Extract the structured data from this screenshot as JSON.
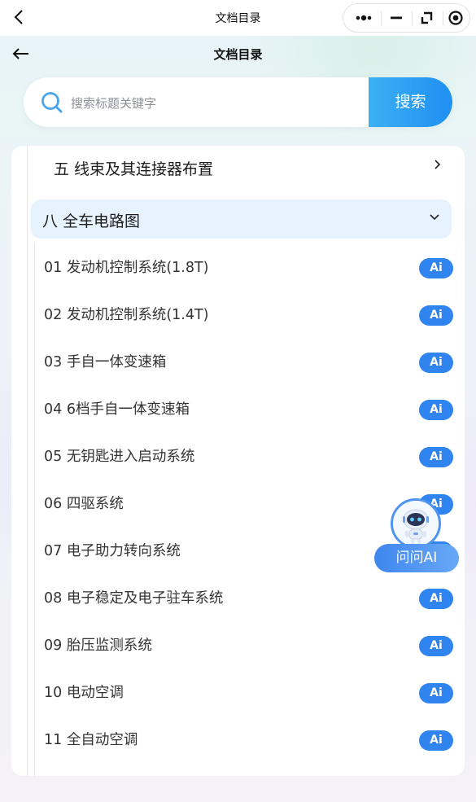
{
  "titlebar": {
    "title": "文档目录"
  },
  "page": {
    "title": "文档目录"
  },
  "search": {
    "placeholder": "搜索标题关键字",
    "button_label": "搜索"
  },
  "chapters": [
    {
      "label": "五 线束及其连接器布置",
      "expanded": false
    },
    {
      "label": "八 全车电路图",
      "expanded": true
    }
  ],
  "items": [
    {
      "label": "01 发动机控制系统(1.8T)",
      "badge": "Ai"
    },
    {
      "label": "02 发动机控制系统(1.4T)",
      "badge": "Ai"
    },
    {
      "label": "03 手自一体变速箱",
      "badge": "Ai"
    },
    {
      "label": "04 6档手自一体变速箱",
      "badge": "Ai"
    },
    {
      "label": "05 无钥匙进入启动系统",
      "badge": "Ai"
    },
    {
      "label": "06 四驱系统",
      "badge": "Ai"
    },
    {
      "label": "07 电子助力转向系统",
      "badge": "Ai"
    },
    {
      "label": "08 电子稳定及电子驻车系统",
      "badge": "Ai"
    },
    {
      "label": "09 胎压监测系统",
      "badge": "Ai"
    },
    {
      "label": "10 电动空调",
      "badge": "Ai"
    },
    {
      "label": "11 全自动空调",
      "badge": "Ai"
    }
  ],
  "assistant": {
    "label": "问问AI"
  },
  "colors": {
    "accent": "#2f84f0",
    "search_button": "#1f8ff2",
    "active_chapter_bg": "#e6f2fd"
  },
  "icons": [
    "back-chevron-icon",
    "more-dots-icon",
    "minimize-icon",
    "switch-icon",
    "record-icon",
    "back-arrow-icon",
    "search-icon",
    "chevron-right-icon",
    "chevron-down-icon",
    "robot-avatar-icon"
  ]
}
